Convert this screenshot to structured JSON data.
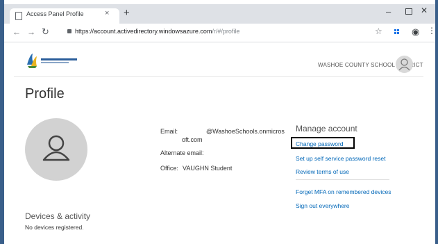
{
  "browser": {
    "tab_title": "Access Panel Profile",
    "tab_close": "×",
    "new_tab": "+",
    "url_main": "https://account.activedirectory.windowsazure.com",
    "url_path": "/r/#/profile",
    "win_min": "–",
    "win_close": "✕"
  },
  "header": {
    "district_name": "WASHOE COUNTY SCHOOL DISTRICT"
  },
  "page": {
    "title": "Profile"
  },
  "user_info": {
    "email_label": "Email:",
    "email_value_line1": "@WashoeSchools.onmicros",
    "email_value_line2": "oft.com",
    "alternate_email_label": "Alternate email:",
    "office_label": "Office:",
    "office_value": "VAUGHN Student"
  },
  "manage_account": {
    "title": "Manage account",
    "links": [
      "Change password",
      "Set up self service password reset",
      "Review terms of use",
      "Forget MFA on remembered devices",
      "Sign out everywhere"
    ]
  },
  "devices": {
    "title": "Devices & activity",
    "subtitle": "No devices registered."
  },
  "colors": {
    "link": "#0067b8",
    "frame": "#3a5f8a",
    "highlight": "#000000"
  }
}
